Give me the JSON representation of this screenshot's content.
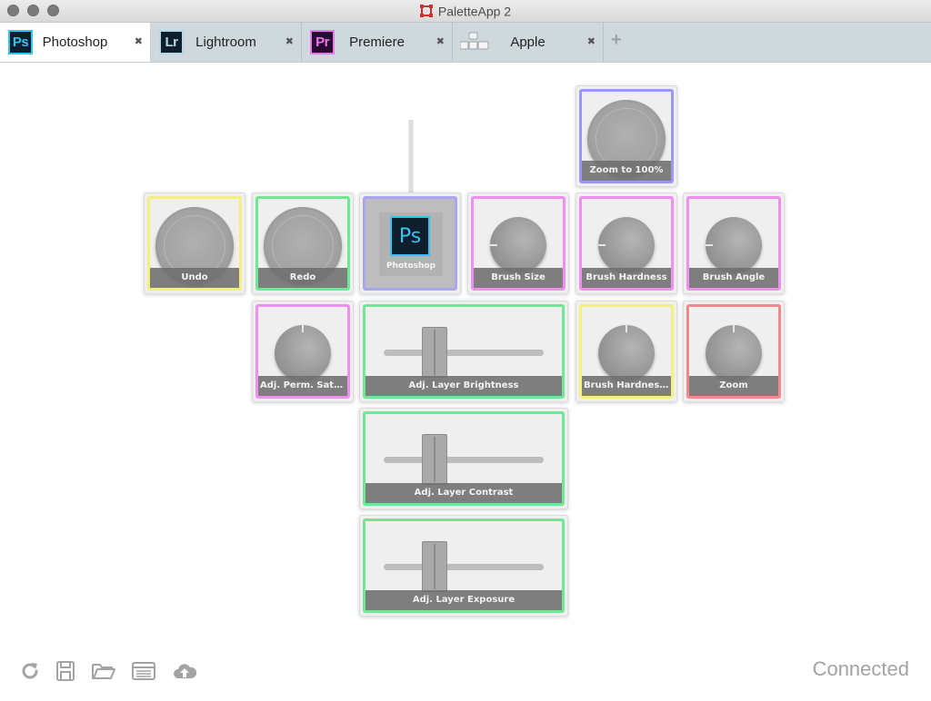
{
  "window": {
    "title": "PaletteApp 2"
  },
  "tabs": [
    {
      "label": "Photoshop",
      "badge": "Ps",
      "badge_color": "#31c5f4",
      "badge_bg": "#0f1e2c",
      "close": "✖",
      "active": true
    },
    {
      "label": "Lightroom",
      "badge": "Lr",
      "badge_color": "#b5d8e6",
      "badge_bg": "#0f1e2c",
      "close": "✖",
      "active": false
    },
    {
      "label": "Premiere",
      "badge": "Pr",
      "badge_color": "#e77ce8",
      "badge_bg": "#2a0a33",
      "close": "✖",
      "active": false
    },
    {
      "label": "Apple",
      "badge": "",
      "close": "✖",
      "active": false
    }
  ],
  "add_tab_glyph": "+",
  "modules": {
    "zoom100": {
      "label": "Zoom to 100%",
      "color": "#9a98f0",
      "kind": "button"
    },
    "undo": {
      "label": "Undo",
      "color": "#f3f081",
      "kind": "button"
    },
    "redo": {
      "label": "Redo",
      "color": "#6fe894",
      "kind": "button"
    },
    "core": {
      "label": "Photoshop",
      "logo": "Ps",
      "color": "#a8a6f2",
      "kind": "core"
    },
    "brush_size": {
      "label": "Brush Size",
      "color": "#ef8ff0",
      "kind": "dial"
    },
    "brush_hardness": {
      "label": "Brush Hardness",
      "color": "#ef8ff0",
      "kind": "dial"
    },
    "brush_angle": {
      "label": "Brush Angle",
      "color": "#ef8ff0",
      "kind": "dial"
    },
    "adj_perm_saturation": {
      "label": "Adj. Perm. Saturati...",
      "color": "#ef8ff0",
      "kind": "dial"
    },
    "adj_layer_brightness": {
      "label": "Adj. Layer Brightness",
      "color": "#6fe894",
      "kind": "slider"
    },
    "brush_hardness_cr": {
      "label": "Brush Hardness/Cr...",
      "color": "#f3f081",
      "kind": "dial"
    },
    "zoom": {
      "label": "Zoom",
      "color": "#f08a8a",
      "kind": "dial"
    },
    "adj_layer_contrast": {
      "label": "Adj. Layer Contrast",
      "color": "#6fe894",
      "kind": "slider"
    },
    "adj_layer_exposure": {
      "label": "Adj. Layer Exposure",
      "color": "#6fe894",
      "kind": "slider"
    }
  },
  "footer": {
    "status": "Connected",
    "icons": [
      "refresh-icon",
      "save-icon",
      "open-folder-icon",
      "layout-list-icon",
      "cloud-upload-icon"
    ]
  }
}
